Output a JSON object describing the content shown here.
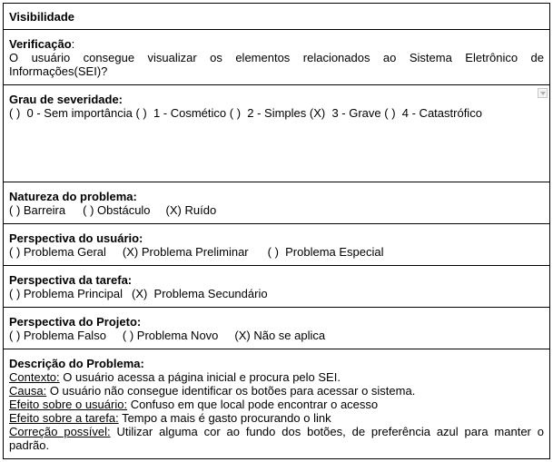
{
  "title": "Visibilidade",
  "verificacao": {
    "label": "Verificação",
    "colon": ":",
    "text": "O usuário consegue visualizar os elementos relacionados ao Sistema Eletrônico de Informações(SEI)?"
  },
  "severidade": {
    "label": "Grau de severidade:",
    "options": [
      "( )  0 - Sem importância",
      "( )  1 - Cosmético",
      "( )  2 - Simples",
      "(X)  3 - Grave",
      "( )  4 - Catastrófico"
    ]
  },
  "natureza": {
    "label": "Natureza do problema:",
    "options": [
      "( ) Barreira",
      "( ) Obstáculo",
      "(X) Ruído"
    ]
  },
  "perspectiva_usuario": {
    "label": "Perspectiva do usuário:",
    "options": [
      "( ) Problema Geral",
      "(X) Problema Preliminar",
      "( )  Problema Especial"
    ]
  },
  "perspectiva_tarefa": {
    "label": "Perspectiva da tarefa:",
    "options": [
      "( ) Problema Principal",
      "(X)  Problema Secundário"
    ]
  },
  "perspectiva_projeto": {
    "label": "Perspectiva do Projeto:",
    "options": [
      "( ) Problema Falso",
      "( ) Problema Novo",
      "(X) Não se aplica"
    ]
  },
  "descricao": {
    "label": "Descrição do Problema:",
    "items": [
      {
        "key": "Contexto:",
        "value": " O usuário acessa a página inicial e procura pelo SEI."
      },
      {
        "key": "Causa:",
        "value": " O usuário não consegue identificar os botões para acessar o sistema."
      },
      {
        "key": "Efeito sobre o usuário:",
        "value": " Confuso em que local pode encontrar o acesso"
      },
      {
        "key": "Efeito sobre a tarefa:",
        "value": " Tempo a mais é gasto procurando o link"
      },
      {
        "key": "Correção possível:",
        "value": " Utilizar alguma cor ao fundo dos botões, de preferência azul para manter o padrão."
      }
    ]
  }
}
